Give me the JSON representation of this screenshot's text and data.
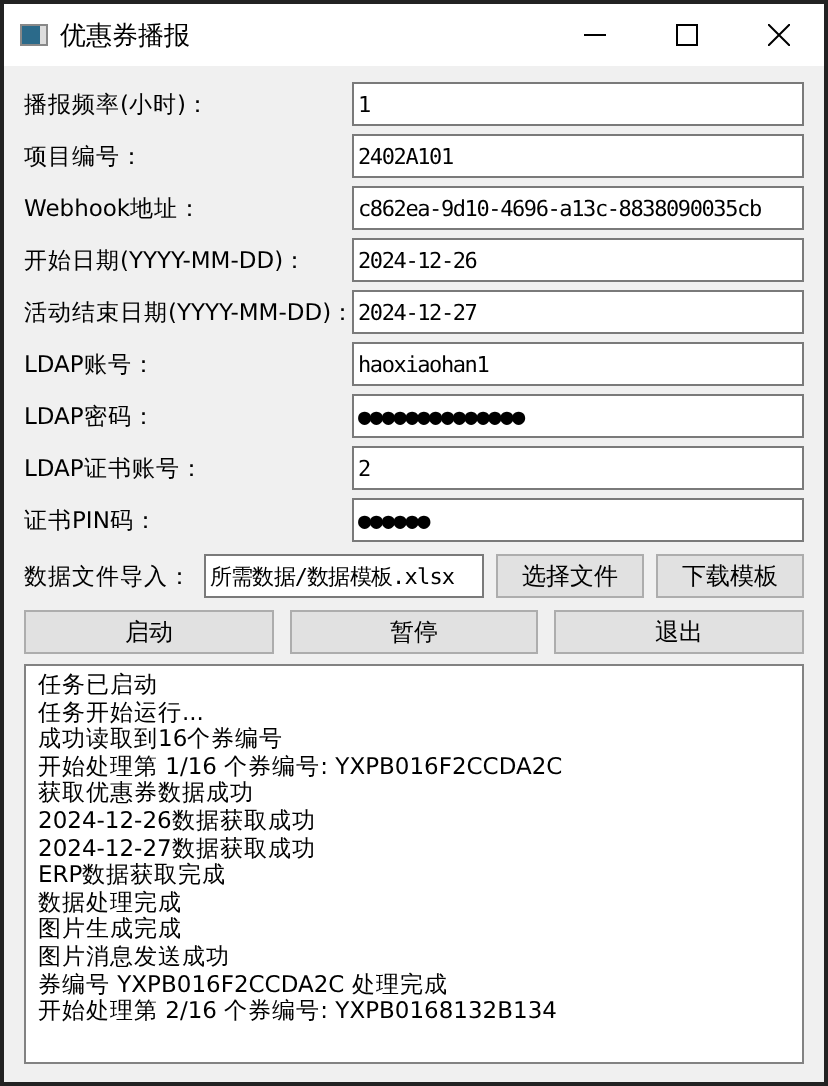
{
  "window": {
    "title": "优惠券播报"
  },
  "fields": [
    {
      "label": "播报频率(小时)：",
      "value": "1"
    },
    {
      "label": "项目编号：",
      "value": "2402A101"
    },
    {
      "label": "Webhook地址：",
      "value": "c862ea-9d10-4696-a13c-8838090035cb"
    },
    {
      "label": "开始日期(YYYY-MM-DD)：",
      "value": "2024-12-26"
    },
    {
      "label": "活动结束日期(YYYY-MM-DD)：",
      "value": "2024-12-27"
    },
    {
      "label": "LDAP账号：",
      "value": "haoxiaohan1"
    },
    {
      "label": "LDAP密码：",
      "value": "●●●●●●●●●●●●●●"
    },
    {
      "label": "LDAP证书账号：",
      "value": "2"
    },
    {
      "label": "证书PIN码：",
      "value": "●●●●●●"
    }
  ],
  "file_import": {
    "label": "数据文件导入：",
    "value": "所需数据/数据模板.xlsx",
    "buttons": [
      "选择文件",
      "下载模板"
    ]
  },
  "actions": [
    "启动",
    "暂停",
    "退出"
  ],
  "log": [
    "任务已启动",
    "任务开始运行...",
    "成功读取到16个券编号",
    "开始处理第 1/16 个券编号: YXPB016F2CCDA2C",
    "获取优惠券数据成功",
    "2024-12-26数据获取成功",
    "2024-12-27数据获取成功",
    "ERP数据获取完成",
    "数据处理完成",
    "图片生成完成",
    "图片消息发送成功",
    "券编号 YXPB016F2CCDA2C 处理完成",
    "开始处理第 2/16 个券编号: YXPB0168132B134"
  ]
}
